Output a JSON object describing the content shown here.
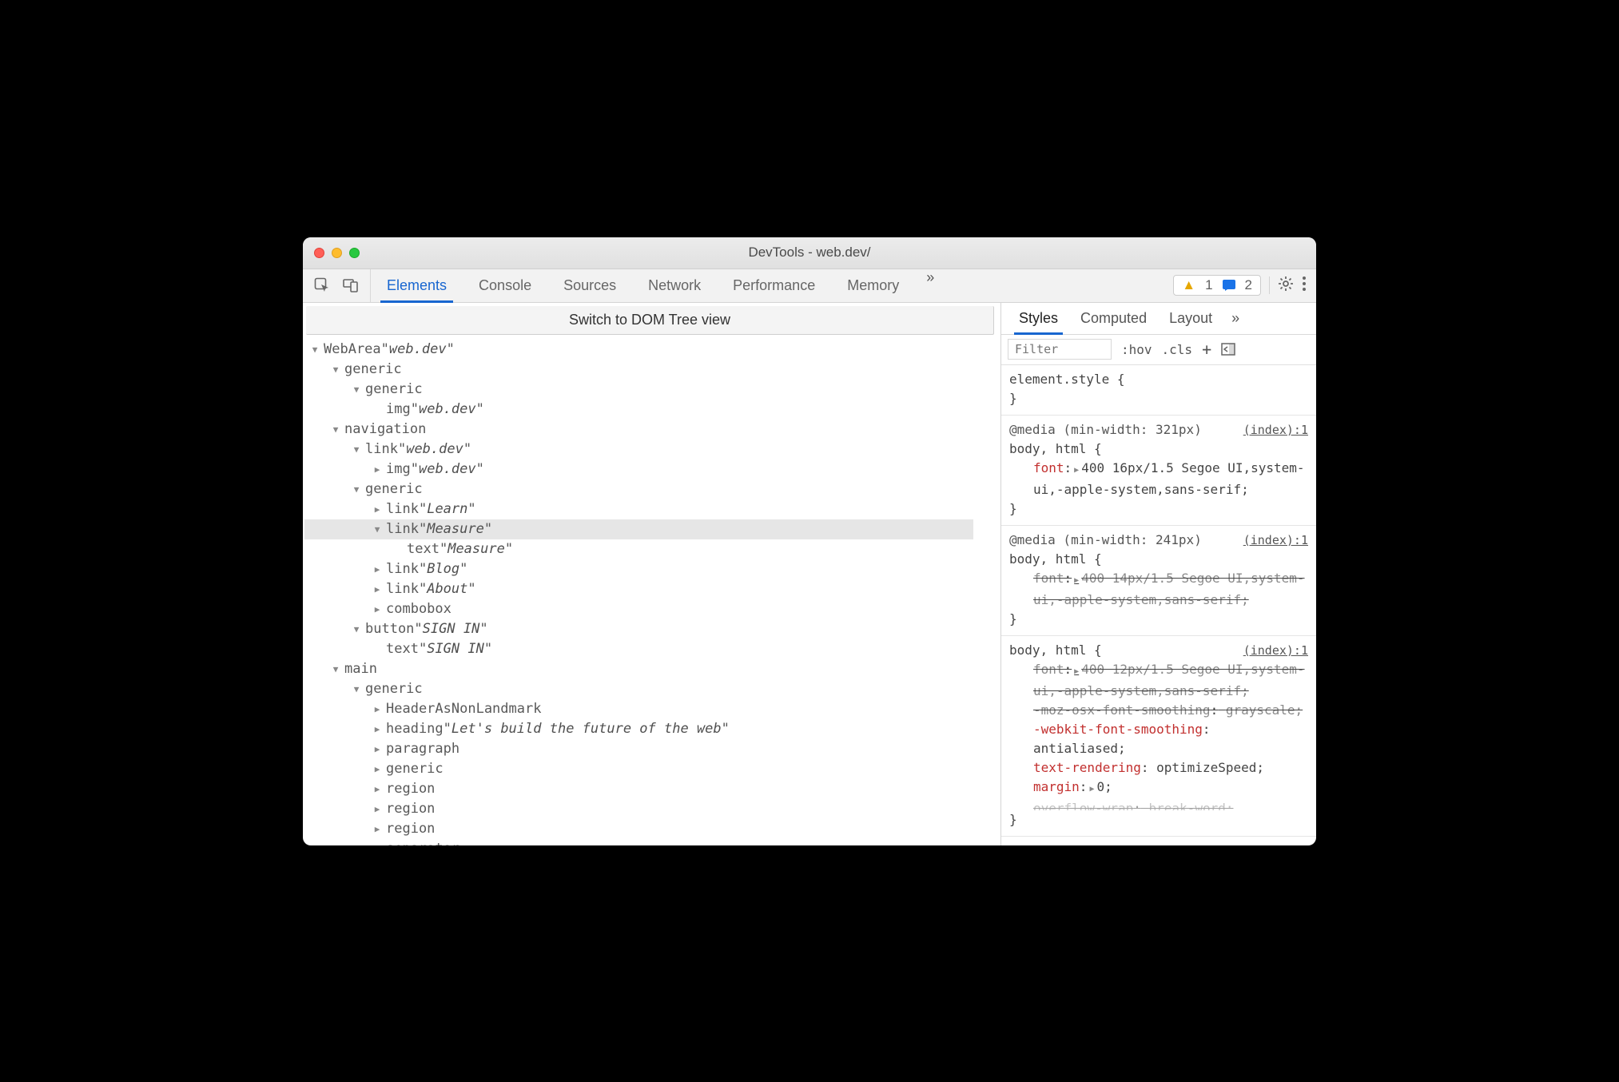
{
  "window": {
    "title": "DevTools - web.dev/"
  },
  "toolbar": {
    "tabs": [
      "Elements",
      "Console",
      "Sources",
      "Network",
      "Performance",
      "Memory"
    ],
    "more": "»",
    "warnings": "1",
    "infos": "2"
  },
  "left": {
    "switch": "Switch to DOM Tree view",
    "tree": [
      {
        "depth": 0,
        "arrow": "down",
        "role": "WebArea",
        "name": "web.dev"
      },
      {
        "depth": 1,
        "arrow": "down",
        "role": "generic"
      },
      {
        "depth": 2,
        "arrow": "down",
        "role": "generic"
      },
      {
        "depth": 3,
        "arrow": "blank",
        "role": "img",
        "name": "web.dev"
      },
      {
        "depth": 1,
        "arrow": "down",
        "role": "navigation"
      },
      {
        "depth": 2,
        "arrow": "down",
        "role": "link",
        "name": "web.dev"
      },
      {
        "depth": 3,
        "arrow": "right",
        "role": "img",
        "name": "web.dev"
      },
      {
        "depth": 2,
        "arrow": "down",
        "role": "generic"
      },
      {
        "depth": 3,
        "arrow": "right",
        "role": "link",
        "name": "Learn"
      },
      {
        "depth": 3,
        "arrow": "down",
        "role": "link",
        "name": "Measure",
        "selected": true
      },
      {
        "depth": 4,
        "arrow": "blank",
        "role": "text",
        "name": "Measure"
      },
      {
        "depth": 3,
        "arrow": "right",
        "role": "link",
        "name": "Blog"
      },
      {
        "depth": 3,
        "arrow": "right",
        "role": "link",
        "name": "About"
      },
      {
        "depth": 3,
        "arrow": "right",
        "role": "combobox"
      },
      {
        "depth": 2,
        "arrow": "down",
        "role": "button",
        "name": "SIGN IN"
      },
      {
        "depth": 3,
        "arrow": "blank",
        "role": "text",
        "name": "SIGN IN"
      },
      {
        "depth": 1,
        "arrow": "down",
        "role": "main"
      },
      {
        "depth": 2,
        "arrow": "down",
        "role": "generic"
      },
      {
        "depth": 3,
        "arrow": "right",
        "role": "HeaderAsNonLandmark"
      },
      {
        "depth": 3,
        "arrow": "right",
        "role": "heading",
        "name": "Let's build the future of the web"
      },
      {
        "depth": 3,
        "arrow": "right",
        "role": "paragraph"
      },
      {
        "depth": 3,
        "arrow": "right",
        "role": "generic"
      },
      {
        "depth": 3,
        "arrow": "right",
        "role": "region"
      },
      {
        "depth": 3,
        "arrow": "right",
        "role": "region"
      },
      {
        "depth": 3,
        "arrow": "right",
        "role": "region"
      },
      {
        "depth": 3,
        "arrow": "blank",
        "role": "separator"
      }
    ]
  },
  "right": {
    "tabs": [
      "Styles",
      "Computed",
      "Layout"
    ],
    "more": "»",
    "filter_placeholder": "Filter",
    "hov": ":hov",
    "cls": ".cls",
    "rules": [
      {
        "selector_main": "element.style",
        "selector_gray": "",
        "open": "{",
        "close": "}",
        "origin": "",
        "media": "",
        "declarations": []
      },
      {
        "media": "@media (min-width: 321px)",
        "selector_main": "body,",
        "selector_gray": " html",
        "open": "{",
        "close": "}",
        "origin": "(index):1",
        "declarations": [
          {
            "prop": "font",
            "val": "400 16px/1.5 Segoe UI,system-ui,-apple-system,sans-serif;",
            "tri": true,
            "strike": false
          }
        ]
      },
      {
        "media": "@media (min-width: 241px)",
        "selector_main": "body,",
        "selector_gray": " html",
        "open": "{",
        "close": "}",
        "origin": "(index):1",
        "declarations": [
          {
            "prop": "font",
            "val": "400 14px/1.5 Segoe UI,system-ui,-apple-system,sans-serif;",
            "tri": true,
            "strike": true
          }
        ]
      },
      {
        "media": "",
        "selector_main": "body,",
        "selector_gray": " html",
        "open": "{",
        "close": "}",
        "origin": "(index):1",
        "declarations": [
          {
            "prop": "font",
            "val": "400 12px/1.5 Segoe UI,system-ui,-apple-system,sans-serif;",
            "tri": true,
            "strike": true
          },
          {
            "prop": "-moz-osx-font-smoothing",
            "val": "grayscale;",
            "strike": true
          },
          {
            "prop": "-webkit-font-smoothing",
            "val": "antialiased;",
            "strike": false
          },
          {
            "prop": "text-rendering",
            "val": "optimizeSpeed;",
            "strike": false
          },
          {
            "prop": "margin",
            "val": "0;",
            "tri": true,
            "strike": false
          },
          {
            "prop": "overflow-wrap",
            "val": "break-word;",
            "strike": true,
            "cut": true
          }
        ]
      }
    ]
  }
}
